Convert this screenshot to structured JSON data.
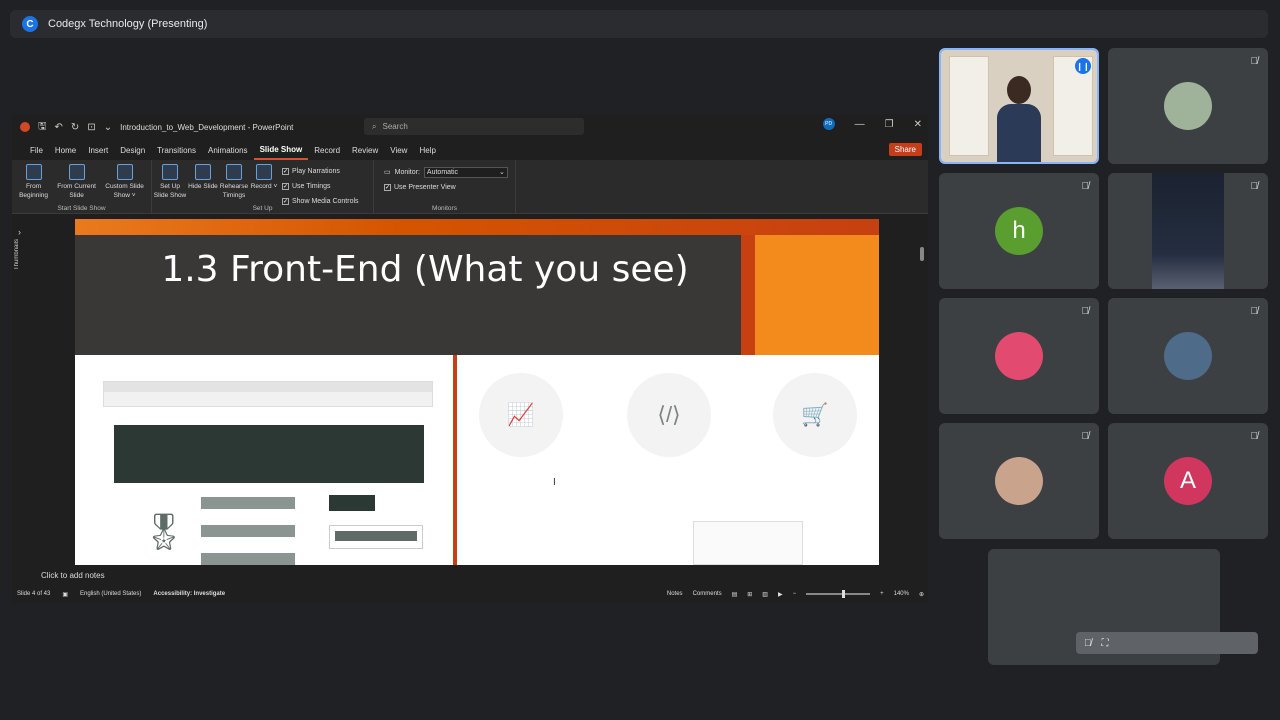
{
  "meeting": {
    "presenter_initial": "C",
    "title": "Codegx Technology (Presenting)"
  },
  "ppt": {
    "doc_title": "Introduction_to_Web_Development  -  PowerPoint",
    "search_placeholder": "Search",
    "account_initials": "PD",
    "tabs": [
      "File",
      "Home",
      "Insert",
      "Design",
      "Transitions",
      "Animations",
      "Slide Show",
      "Record",
      "Review",
      "View",
      "Help"
    ],
    "share_label": "Share",
    "ribbon": {
      "from_beginning": "From Beginning",
      "from_current": "From Current Slide",
      "custom_show": "Custom Slide Show ˅",
      "group_start": "Start Slide Show",
      "setup_show": "Set Up Slide Show",
      "hide_slide": "Hide Slide",
      "rehearse": "Rehearse Timings",
      "record": "Record ˅",
      "play_narrations": "Play Narrations",
      "use_timings": "Use Timings",
      "show_media": "Show Media Controls",
      "group_setup": "Set Up",
      "monitor_label": "Monitor:",
      "monitor_value": "Automatic",
      "presenter_view": "Use Presenter View",
      "group_monitors": "Monitors"
    },
    "thumbnails_label": "Thumbnails",
    "slide": {
      "title": "1.3 Front-End (What you see)"
    },
    "notes_placeholder": "Click to add notes",
    "status": {
      "slide_count": "Slide 4 of 43",
      "language": "English (United States)",
      "accessibility": "Accessibility: Investigate",
      "notes": "Notes",
      "comments": "Comments",
      "zoom": "140%"
    }
  },
  "participants": [
    {
      "name": "speaker-video",
      "initial": "",
      "color": "",
      "muted": false
    },
    {
      "name": "participant-photo-1",
      "initial": "",
      "color": "#9fb39a",
      "muted": true
    },
    {
      "name": "participant-h",
      "initial": "h",
      "color": "#5a9e2f",
      "muted": true
    },
    {
      "name": "participant-dark-video",
      "initial": "",
      "color": "",
      "muted": true
    },
    {
      "name": "participant-photo-2",
      "initial": "",
      "color": "#e34a6f",
      "muted": true
    },
    {
      "name": "participant-photo-3",
      "initial": "",
      "color": "#4e6b8a",
      "muted": true
    },
    {
      "name": "participant-photo-4",
      "initial": "",
      "color": "#c9a38c",
      "muted": true
    },
    {
      "name": "participant-a",
      "initial": "A",
      "color": "#d1365f",
      "muted": true
    }
  ]
}
